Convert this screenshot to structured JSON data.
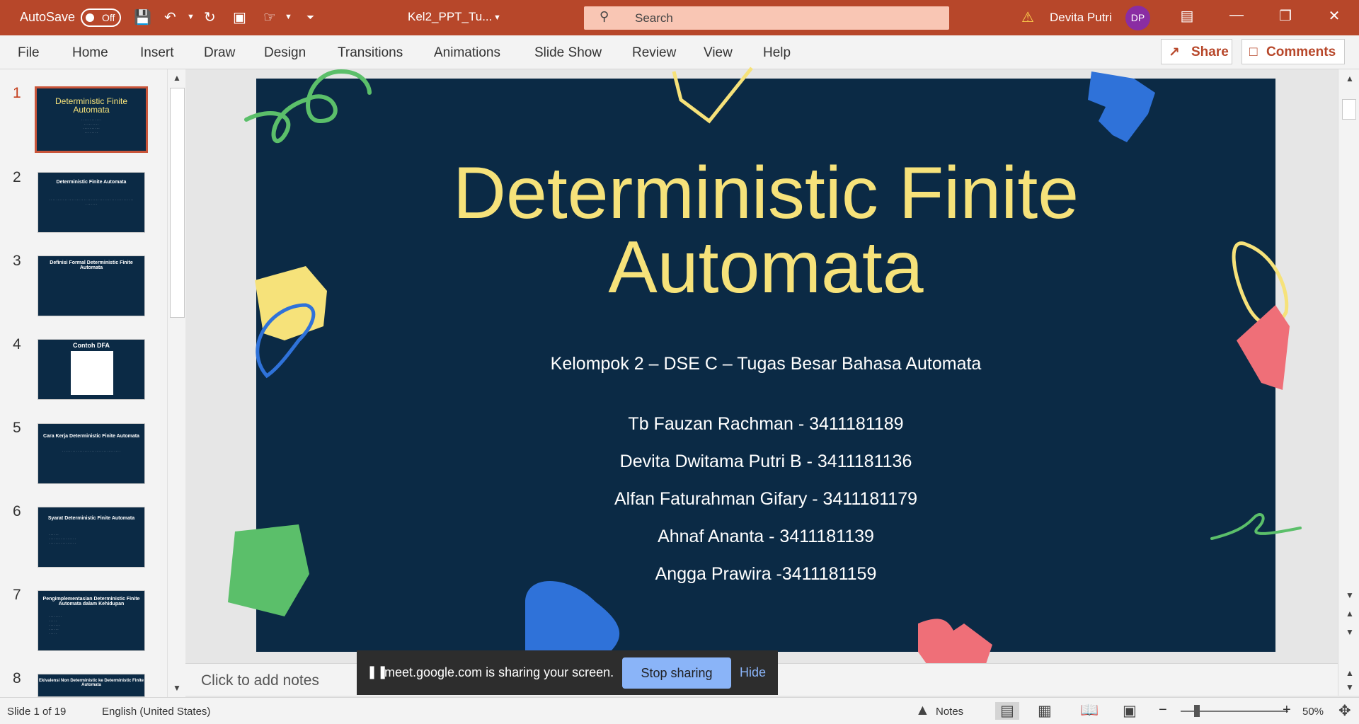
{
  "titlebar": {
    "autosave_label": "AutoSave",
    "autosave_state": "Off",
    "filename": "Kel2_PPT_Tu...",
    "search_placeholder": "Search",
    "user_name": "Devita Putri",
    "user_initials": "DP"
  },
  "menu": {
    "items": [
      "File",
      "Home",
      "Insert",
      "Draw",
      "Design",
      "Transitions",
      "Animations",
      "Slide Show",
      "Review",
      "View",
      "Help"
    ],
    "share": "Share",
    "comments": "Comments"
  },
  "thumbnails": [
    {
      "num": "1",
      "title": "Deterministic Finite Automata"
    },
    {
      "num": "2",
      "title": "Deterministic Finite Automata"
    },
    {
      "num": "3",
      "title": "Definisi Formal Deterministic Finite Automata"
    },
    {
      "num": "4",
      "title": "Contoh DFA"
    },
    {
      "num": "5",
      "title": "Cara Kerja Deterministic Finite Automata"
    },
    {
      "num": "6",
      "title": "Syarat Deterministic Finite Automata"
    },
    {
      "num": "7",
      "title": "Pengimplementasian Deterministic Finite Automata dalam Kehidupan"
    },
    {
      "num": "8",
      "title": "Ekivalensi Non Deterministic ke Deterministic Finite Automata"
    }
  ],
  "slide": {
    "title_line1": "Deterministic Finite",
    "title_line2": "Automata",
    "subtitle": "Kelompok 2 – DSE C – Tugas Besar Bahasa Automata",
    "members": [
      "Tb Fauzan Rachman - 3411181189",
      "Devita Dwitama Putri B - 3411181136",
      "Alfan Faturahman Gifary - 3411181179",
      "Ahnaf Ananta - 3411181139",
      "Angga Prawira -3411181159"
    ]
  },
  "notes_placeholder": "Click to add notes",
  "status": {
    "slide_count": "Slide 1 of 19",
    "language": "English (United States)",
    "notes": "Notes",
    "zoom": "50%"
  },
  "share_bar": {
    "message": "meet.google.com is sharing your screen.",
    "stop": "Stop sharing",
    "hide": "Hide"
  },
  "colors": {
    "accent": "#b7472a",
    "slide_bg": "#0b2a45",
    "title_yellow": "#f6e27a"
  }
}
